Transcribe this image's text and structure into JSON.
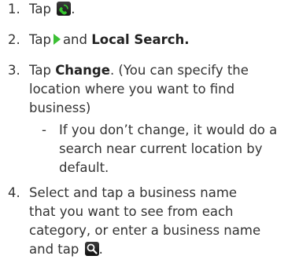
{
  "steps": [
    {
      "num": "1.",
      "text": "Tap",
      "icon": "phone-icon",
      "icon_color": "#2fbf2a",
      "end": "."
    },
    {
      "num": "2.",
      "pre": "Tap",
      "icon": "play-arrow-icon",
      "icon_color": "#3cc035",
      "mid": "and",
      "bold": "Local Search."
    },
    {
      "num": "3.",
      "pre": "Tap",
      "bold": "Change",
      "post": ". (You can specify the",
      "line2": "location where you want to find",
      "line3": "business)",
      "sub": {
        "dash": "-",
        "line1": "If you don’t change, it would do a",
        "line2": "search near current location by",
        "line3": "default."
      }
    },
    {
      "num": "4.",
      "line1": "Select and tap a business name",
      "line2": "that you want to see from each",
      "line3": "category, or enter a business name",
      "line4": "and tap",
      "icon": "search-icon",
      "end": "."
    }
  ]
}
